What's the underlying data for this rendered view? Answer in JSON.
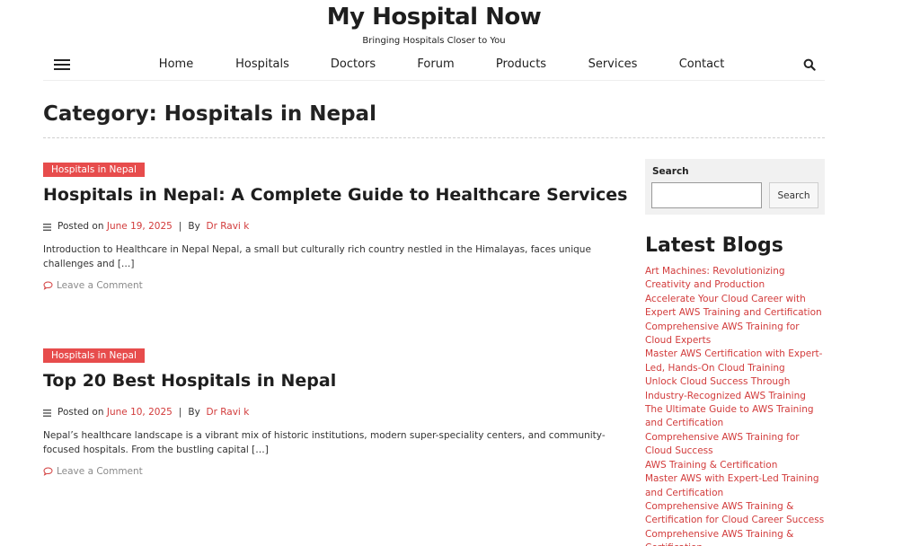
{
  "site": {
    "title": "My Hospital Now",
    "tagline": "Bringing Hospitals Closer to You"
  },
  "nav": {
    "items": [
      "Home",
      "Hospitals",
      "Doctors",
      "Forum",
      "Products",
      "Services",
      "Contact"
    ]
  },
  "page": {
    "heading": "Category: Hospitals in Nepal"
  },
  "posts": [
    {
      "category": "Hospitals in Nepal",
      "title": "Hospitals in Nepal: A Complete Guide to Healthcare Services",
      "posted_on_label": "Posted on",
      "date": "June 19, 2025",
      "separator": "|",
      "by_label": "By",
      "author": "Dr Ravi k",
      "excerpt": "Introduction to Healthcare in Nepal Nepal, a small but culturally rich country nestled in the Himalayas, faces unique challenges and […]",
      "comment_link": "Leave a Comment"
    },
    {
      "category": "Hospitals in Nepal",
      "title": "Top 20 Best Hospitals in Nepal",
      "posted_on_label": "Posted on",
      "date": "June 10, 2025",
      "separator": "|",
      "by_label": "By",
      "author": "Dr Ravi k",
      "excerpt": "Nepal’s healthcare landscape is a vibrant mix of historic institutions, modern super-speciality centers, and community-focused hospitals. From the bustling capital […]",
      "comment_link": "Leave a Comment"
    }
  ],
  "sidebar": {
    "search": {
      "label": "Search",
      "button": "Search",
      "value": ""
    },
    "latest_blogs": {
      "heading": "Latest Blogs",
      "items": [
        "Art Machines: Revolutionizing Creativity and Production",
        "Accelerate Your Cloud Career with Expert AWS Training and Certification",
        "Comprehensive AWS Training for Cloud Experts",
        "Master AWS Certification with Expert-Led, Hands-On Cloud Training",
        "Unlock Cloud Success Through Industry-Recognized AWS Training",
        "The Ultimate Guide to AWS Training and Certification",
        "Comprehensive AWS Training for Cloud Success",
        "AWS Training & Certification",
        "Master AWS with Expert-Led Training and Certification",
        "Comprehensive AWS Training & Certification for Cloud Career Success",
        "Comprehensive AWS Training & Certification"
      ]
    }
  },
  "colors": {
    "accent": "#e74c4c",
    "link": "#d23b3b",
    "text": "#1e1e1e"
  },
  "icons": {
    "menu": "hamburger-icon",
    "search": "magnifier-icon",
    "meta": "list-icon",
    "comment": "speech-bubble-icon"
  }
}
